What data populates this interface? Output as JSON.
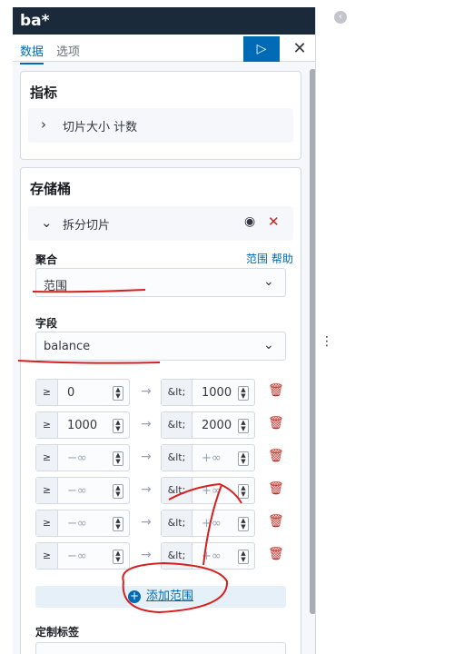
{
  "header": {
    "title": "ba*"
  },
  "tabs": [
    {
      "label": "数据"
    },
    {
      "label": "选项"
    }
  ],
  "toolbar": {
    "run_icon": "play-icon",
    "close_icon": "close-icon"
  },
  "metrics": {
    "title": "指标",
    "item_label": "切片大小 计数"
  },
  "buckets": {
    "title": "存储桶",
    "split_label": "拆分切片",
    "aggregation": {
      "label": "聚合",
      "help": "范围 帮助",
      "value": "范围"
    },
    "field": {
      "label": "字段",
      "value": "balance"
    },
    "ranges": [
      {
        "from_prefix": "≥",
        "from": "0",
        "to_prefix": "&lt;",
        "to": "1000"
      },
      {
        "from_prefix": "≥",
        "from": "1000",
        "to_prefix": "&lt;",
        "to": "2000"
      },
      {
        "from_prefix": "≥",
        "from": "−∞",
        "to_prefix": "&lt;",
        "to": "+∞"
      },
      {
        "from_prefix": "≥",
        "from": "−∞",
        "to_prefix": "&lt;",
        "to": "+∞"
      },
      {
        "from_prefix": "≥",
        "from": "−∞",
        "to_prefix": "&lt;",
        "to": "+∞"
      },
      {
        "from_prefix": "≥",
        "from": "−∞",
        "to_prefix": "&lt;",
        "to": "+∞"
      }
    ],
    "add_range": "添加范围",
    "custom_label": "定制标签"
  },
  "colors": {
    "accent": "#006bb4",
    "danger": "#bd271e",
    "title_bg": "#1a2a3a",
    "annotation": "#d62020"
  }
}
